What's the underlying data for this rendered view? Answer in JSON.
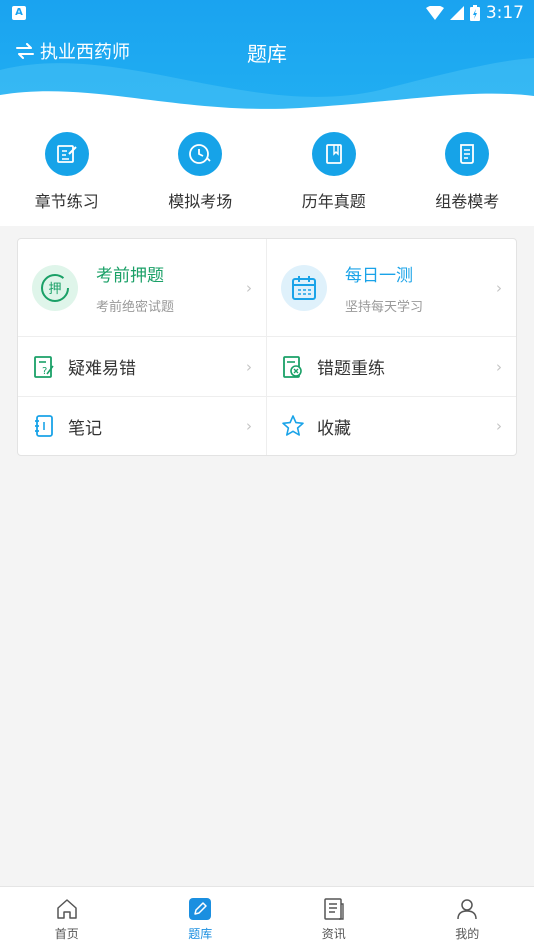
{
  "status_bar": {
    "left_badge": "A",
    "time": "3:17"
  },
  "header": {
    "switch_label": "执业西药师",
    "title": "题库"
  },
  "quick_nav": [
    {
      "label": "章节练习",
      "icon": "edit-note-icon"
    },
    {
      "label": "模拟考场",
      "icon": "clock-icon"
    },
    {
      "label": "历年真题",
      "icon": "book-icon"
    },
    {
      "label": "组卷模考",
      "icon": "scroll-icon"
    }
  ],
  "grid": {
    "predict": {
      "title": "考前押题",
      "subtitle": "考前绝密试题",
      "icon_text": "押",
      "color": "#1aa067"
    },
    "daily": {
      "title": "每日一测",
      "subtitle": "坚持每天学习",
      "color": "#1aa3e8"
    },
    "hard": {
      "label": "疑难易错"
    },
    "wrong": {
      "label": "错题重练"
    },
    "notes": {
      "label": "笔记"
    },
    "favorites": {
      "label": "收藏"
    },
    "chevron": "›"
  },
  "tabbar": {
    "tabs": [
      {
        "label": "首页"
      },
      {
        "label": "题库"
      },
      {
        "label": "资讯"
      },
      {
        "label": "我的"
      }
    ],
    "active_color": "#1b8fe0"
  }
}
